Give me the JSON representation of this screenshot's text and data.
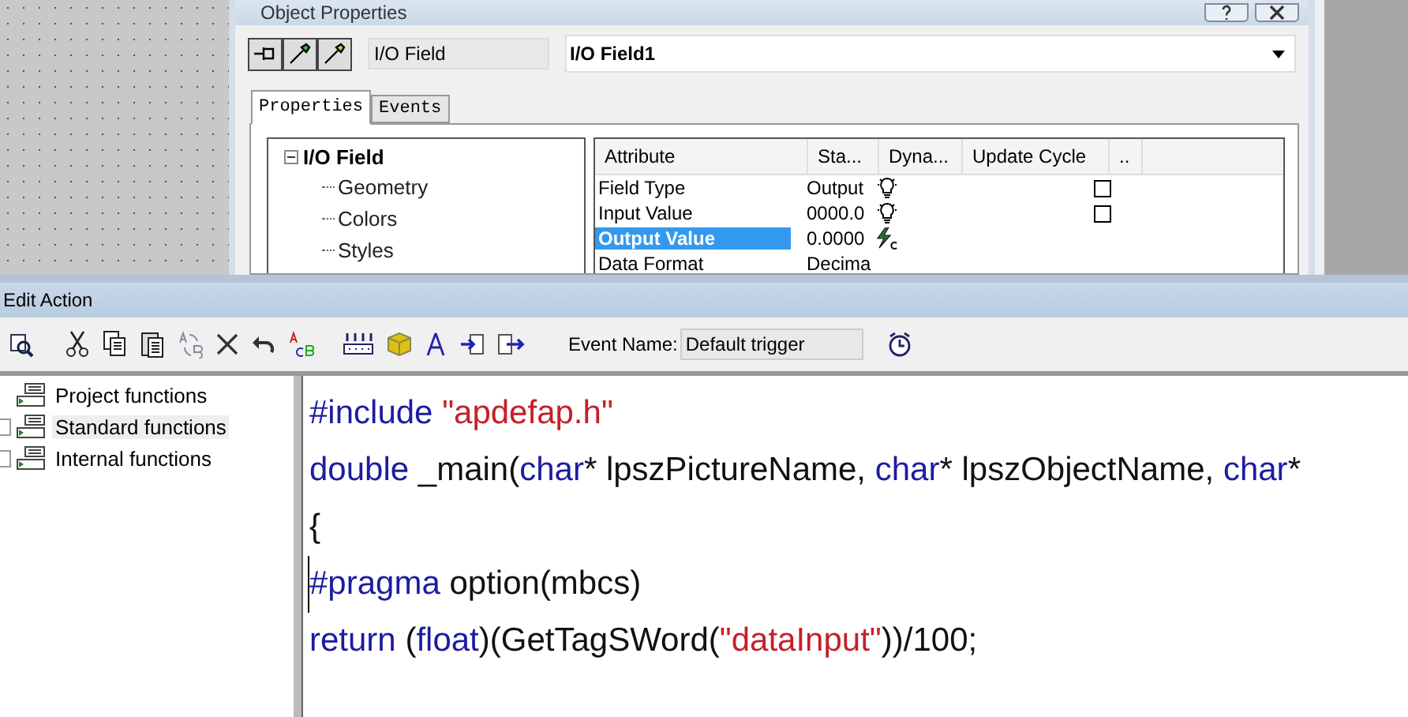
{
  "object_properties": {
    "title": "Object Properties",
    "object_type": "I/O Field",
    "object_name": "I/O Field1",
    "tabs": [
      {
        "label": "Properties",
        "selected": true
      },
      {
        "label": "Events",
        "selected": false
      }
    ],
    "tree": {
      "label": "I/O Field",
      "expanded": true,
      "children": [
        {
          "label": "Geometry"
        },
        {
          "label": "Colors"
        },
        {
          "label": "Styles"
        }
      ]
    },
    "table": {
      "columns": [
        "Attribute",
        "Sta...",
        "Dyna...",
        "Update Cycle",
        ".."
      ],
      "rows": [
        {
          "attribute": "Field Type",
          "static": "Output",
          "kind": "bulb",
          "checked": false,
          "selected": false
        },
        {
          "attribute": "Input Value",
          "static": "0000.0",
          "kind": "bulb",
          "checked": false,
          "selected": false
        },
        {
          "attribute": "Output Value",
          "static": "0.0000",
          "kind": "script",
          "selected": true
        },
        {
          "attribute": "Data Format",
          "static": "Decima",
          "selected": false
        }
      ]
    }
  },
  "edit_action": {
    "title": "Edit Action",
    "event_name_label": "Event Name:",
    "event_name": "Default trigger",
    "functions": [
      {
        "label": "Project functions",
        "has_children": false,
        "selected": false
      },
      {
        "label": "Standard functions",
        "has_children": true,
        "selected": true
      },
      {
        "label": "Internal functions",
        "has_children": true,
        "selected": false
      }
    ],
    "code": [
      [
        {
          "kind": "keyword",
          "text": "#include"
        },
        {
          "kind": "string",
          "text": " \"apdefap.h\""
        }
      ],
      [
        {
          "kind": "keyword",
          "text": " double"
        },
        {
          "kind": "plain",
          "text": " _main("
        },
        {
          "kind": "keyword",
          "text": "char"
        },
        {
          "kind": "plain",
          "text": "* lpszPictureName, "
        },
        {
          "kind": "keyword",
          "text": "char"
        },
        {
          "kind": "plain",
          "text": "* lpszObjectName, "
        },
        {
          "kind": "keyword",
          "text": "char"
        },
        {
          "kind": "plain",
          "text": "*"
        }
      ],
      [
        {
          "kind": "plain",
          "text": "{"
        }
      ],
      [
        {
          "kind": "keyword",
          "text": "#pragma"
        },
        {
          "kind": "plain",
          "text": " option(mbcs)"
        }
      ],
      [
        {
          "kind": "keyword",
          "text": "return"
        },
        {
          "kind": "plain",
          "text": " ("
        },
        {
          "kind": "keyword",
          "text": "float"
        },
        {
          "kind": "plain",
          "text": ")(GetTagSWord("
        },
        {
          "kind": "string",
          "text": "\"dataInput\""
        },
        {
          "kind": "plain",
          "text": "))/100;"
        }
      ]
    ]
  }
}
